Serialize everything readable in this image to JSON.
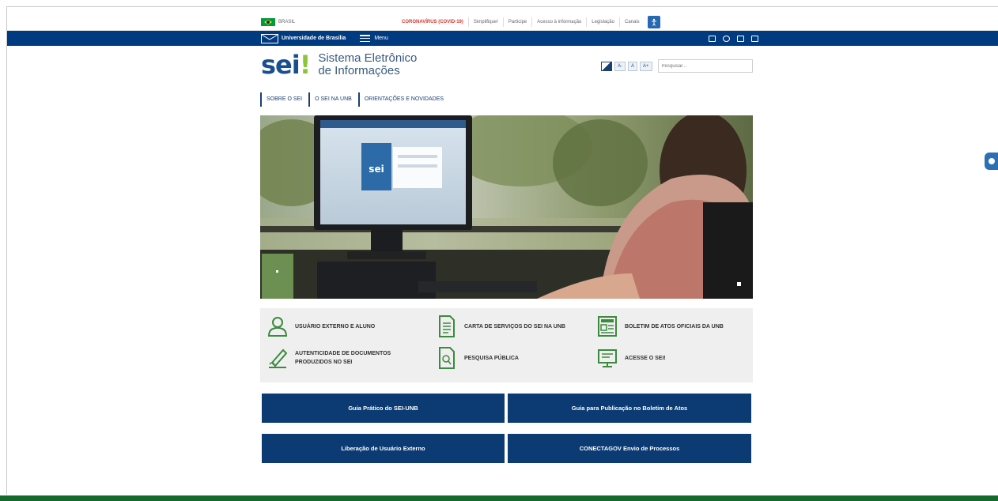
{
  "govbar": {
    "brasil": "BRASIL",
    "links": [
      "CORONAVÍRUS (COVID-19)",
      "Simplifique!",
      "Participe",
      "Acesso à informação",
      "Legislação",
      "Canais"
    ],
    "flag_color": "#009b3a"
  },
  "unbbar": {
    "title": "Universidade de Brasília",
    "menu": "Menu",
    "bg_color": "#003a80"
  },
  "header": {
    "logo_text": "sei",
    "logo_mark": "!",
    "title_line1": "Sistema Eletrônico",
    "title_line2": "de Informações",
    "font_decrease": "A-",
    "font_normal": "A",
    "font_increase": "A+",
    "search_placeholder": "Pesquisar..."
  },
  "nav": {
    "items": [
      "SOBRE O SEI",
      "O SEI NA UNB",
      "ORIENTAÇÕES E NOVIDADES"
    ]
  },
  "hero": {
    "screen_logo": "sei"
  },
  "services": [
    {
      "label": "USUÁRIO EXTERNO E ALUNO",
      "icon": "user-icon"
    },
    {
      "label": "CARTA DE SERVIÇOS DO SEI NA UnB",
      "icon": "document-icon"
    },
    {
      "label": "BOLETIM DE ATOS OFICIAIS DA UnB",
      "icon": "newspaper-icon"
    },
    {
      "label": "AUTENTICIDADE DE DOCUMENTOS PRODUZIDOS NO SEI",
      "icon": "signature-icon"
    },
    {
      "label": "PESQUISA PÚBLICA",
      "icon": "document-search-icon"
    },
    {
      "label": "ACESSE O SEI!",
      "icon": "monitor-icon"
    }
  ],
  "buttons": [
    "Guia Prático do SEI-UNB",
    "Guia para Publicação no Boletim de Atos",
    "Liberação de Usuário Externo",
    "CONECTAGOV Envio de Processos"
  ],
  "colors": {
    "primary": "#0b3b72",
    "accent_green": "#8cc43c",
    "footer": "#146a2e",
    "covid": "#d9362c"
  }
}
